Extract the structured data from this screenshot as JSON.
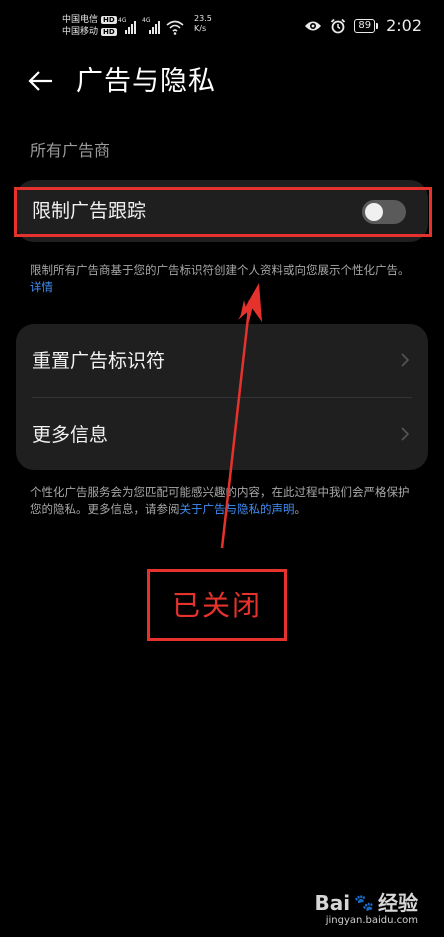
{
  "status_bar": {
    "carrier_1": "中国电信",
    "carrier_2": "中国移动",
    "hd_badge": "HD",
    "signal_tag": "4G",
    "net_speed_value": "23.5",
    "net_speed_unit": "K/s",
    "battery_level": "89",
    "time": "2:02"
  },
  "header": {
    "title": "广告与隐私"
  },
  "section": {
    "label": "所有广告商"
  },
  "limit_tracking": {
    "label": "限制广告跟踪",
    "enabled": false
  },
  "limit_desc": {
    "text": "限制所有广告商基于您的广告标识符创建个人资料或向您展示个性化广告。",
    "link": "详情"
  },
  "menu": {
    "items": [
      {
        "label": "重置广告标识符"
      },
      {
        "label": "更多信息"
      }
    ]
  },
  "info_desc": {
    "text_before": "个性化广告服务会为您匹配可能感兴趣的内容，在此过程中我们会严格保护您的隐私。更多信息，请参阅",
    "link": "关于广告与隐私的声明",
    "text_after": "。"
  },
  "annotation": {
    "text": "已关闭",
    "color": "#e5322d"
  },
  "watermark": {
    "brand": "Bai",
    "brand_suffix": "经验",
    "site": "jingyan.baidu.com"
  },
  "colors": {
    "background": "#000000",
    "card": "#1f1f1f",
    "link": "#3f8ff7",
    "toggle_off": "#5a5a5a"
  }
}
